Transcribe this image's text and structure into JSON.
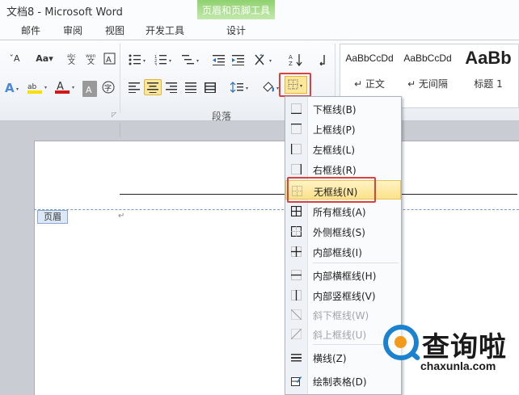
{
  "window": {
    "title": "文档8 - Microsoft Word"
  },
  "contextual_tab": {
    "title": "页眉和页脚工具",
    "tab": "设计"
  },
  "tabs": [
    "邮件",
    "审阅",
    "视图",
    "开发工具"
  ],
  "ribbon": {
    "font_row1": [
      "ˇA",
      "Aa▾"
    ],
    "para_group_label": "段落",
    "styles": [
      {
        "sample": "AaBbCcDd",
        "name": "↵ 正文"
      },
      {
        "sample": "AaBbCcDd",
        "name": "↵ 无间隔"
      },
      {
        "sample": "AaBb",
        "name": "标题 1"
      }
    ]
  },
  "document": {
    "header_tag": "页眉",
    "para_mark": "↵"
  },
  "border_menu": {
    "items": [
      {
        "label": "下框线(B)",
        "icon": "bottom-border-icon",
        "disabled": false
      },
      {
        "label": "上框线(P)",
        "icon": "top-border-icon",
        "disabled": false
      },
      {
        "label": "左框线(L)",
        "icon": "left-border-icon",
        "disabled": false
      },
      {
        "label": "右框线(R)",
        "icon": "right-border-icon",
        "disabled": false
      },
      {
        "label": "无框线(N)",
        "icon": "no-border-icon",
        "disabled": false,
        "highlighted": true
      },
      {
        "label": "所有框线(A)",
        "icon": "all-borders-icon",
        "disabled": false
      },
      {
        "label": "外侧框线(S)",
        "icon": "outside-borders-icon",
        "disabled": false
      },
      {
        "label": "内部框线(I)",
        "icon": "inside-borders-icon",
        "disabled": false
      },
      {
        "label": "内部横框线(H)",
        "icon": "inside-horizontal-border-icon",
        "disabled": false
      },
      {
        "label": "内部竖框线(V)",
        "icon": "inside-vertical-border-icon",
        "disabled": false
      },
      {
        "label": "斜下框线(W)",
        "icon": "diagonal-down-border-icon",
        "disabled": true
      },
      {
        "label": "斜上框线(U)",
        "icon": "diagonal-up-border-icon",
        "disabled": true
      },
      {
        "label": "横线(Z)",
        "icon": "horizontal-line-icon",
        "disabled": false
      },
      {
        "label": "绘制表格(D)",
        "icon": "draw-table-icon",
        "disabled": false
      }
    ]
  },
  "watermark": {
    "cn": "查询啦",
    "en": "chaxunla.com"
  },
  "colors": {
    "highlight_box": "#d9433d",
    "contextual_green": "#8fd06f",
    "selected_fill": "#fde79a"
  }
}
